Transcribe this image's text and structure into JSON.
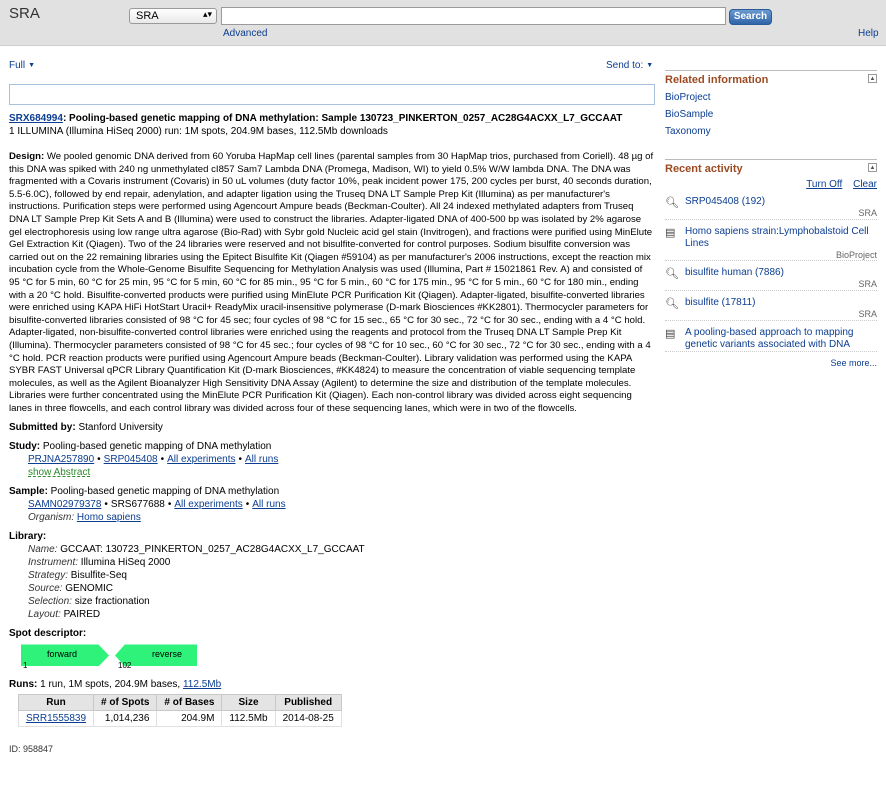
{
  "header": {
    "app_title": "SRA",
    "db_selected": "SRA",
    "search_value": "",
    "search_button": "Search",
    "advanced_link": "Advanced",
    "help_link": "Help"
  },
  "toolbar": {
    "format_label": "Full",
    "send_to_label": "Send to:"
  },
  "record": {
    "accession": "SRX684994",
    "title": ": Pooling-based genetic mapping of DNA methylation: Sample 130723_PINKERTON_0257_AC28G4ACXX_L7_GCCAAT",
    "subtitle": "1 ILLUMINA (Illumina HiSeq 2000) run: 1M spots, 204.9M bases, 112.5Mb downloads",
    "design_label": "Design:",
    "design_text": " We pooled genomic DNA derived from 60 Yoruba HapMap cell lines (parental samples from 30 HapMap trios, purchased from Coriell). 48 µg of this DNA was spiked with 240 ng unmethylated cI857 Sam7 Lambda DNA (Promega, Madison, WI) to yield 0.5% W/W lambda DNA. The DNA was fragmented with a Covaris instrument (Covaris) in 50 uL volumes (duty factor 10%, peak incident power 175, 200 cycles per burst, 40 seconds duration, 5.5-6.0C), followed by end repair, adenylation, and adapter ligation using the Truseq DNA LT Sample Prep Kit (Illumina) as per manufacturer's instructions. Purification steps were performed using Agencourt Ampure beads (Beckman-Coulter). All 24 indexed methylated adapters from Truseq DNA LT Sample Prep Kit Sets A and B (Illumina) were used to construct the libraries. Adapter-ligated DNA of 400-500 bp was isolated by 2% agarose gel electrophoresis using low range ultra agarose (Bio-Rad) with Sybr gold Nucleic acid gel stain (Invitrogen), and fractions were purified using MinElute Gel Extraction Kit (Qiagen). Two of the 24 libraries were reserved and not bisulfite-converted for control purposes. Sodium bisulfite conversion was carried out on the 22 remaining libraries using the Epitect Bisulfite Kit (Qiagen #59104) as per manufacturer's 2006 instructions, except the reaction mix incubation cycle from the Whole-Genome Bisulfite Sequencing for Methylation Analysis was used (Illumina, Part # 15021861 Rev. A) and consisted of 95 °C for 5 min, 60 °C for 25 min, 95 °C for 5 min, 60 °C for 85 min., 95 °C for 5 min., 60 °C for 175 min., 95 °C for 5 min., 60 °C for 180 min., ending with a 20 °C hold. Bisulfite-converted products were purified using MinElute PCR Purification Kit (Qiagen). Adapter-ligated, bisulfite-converted libraries were enriched using KAPA HiFi HotStart Uracil+ ReadyMix uracil-insensitive polymerase (D-mark Biosciences #KK2801). Thermocycler parameters for bisulfite-converted libraries consisted of 98 °C for 45 sec; four cycles of 98 °C for 15 sec., 65 °C for 30 sec., 72 °C for 30 sec., ending with a 4 °C hold. Adapter-ligated, non-bisulfite-converted control libraries were enriched using the reagents and protocol from the Truseq DNA LT Sample Prep Kit (Illumina). Thermocycler parameters consisted of 98 °C for 45 sec.; four cycles of 98 °C for 10 sec., 60 °C for 30 sec., 72 °C for 30 sec., ending with a 4 °C hold. PCR reaction products were purified using Agencourt Ampure beads (Beckman-Coulter). Library validation was performed using the KAPA SYBR FAST Universal qPCR Library Quantification Kit (D-mark Biosciences, #KK4824) to measure the concentration of viable sequencing template molecules, as well as the Agilent Bioanalyzer High Sensitivity DNA Assay (Agilent) to determine the size and distribution of the template molecules. Libraries were further concentrated using the MinElute PCR Purification Kit (Qiagen). Each non-control library was divided across eight sequencing lanes in three flowcells, and each control library was divided across four of these sequencing lanes, which were in two of the flowcells.",
    "submitted_label": "Submitted by:",
    "submitted_value": " Stanford University",
    "study_label": "Study:",
    "study_value": " Pooling-based genetic mapping of DNA methylation",
    "study_links": [
      "PRJNA257890",
      "SRP045408",
      "All experiments",
      "All runs"
    ],
    "show_abstract": "show Abstract",
    "sample_label": "Sample:",
    "sample_value": " Pooling-based genetic mapping of DNA methylation",
    "sample_id_link": "SAMN02979378",
    "sample_srs": "SRS677688",
    "sample_links": [
      "All experiments",
      "All runs"
    ],
    "organism_label": "Organism:",
    "organism_value": "Homo sapiens",
    "library_label": "Library:",
    "library_fields": [
      {
        "label": "Name:",
        "value": " GCCAAT: 130723_PINKERTON_0257_AC28G4ACXX_L7_GCCAAT"
      },
      {
        "label": "Instrument:",
        "value": " Illumina HiSeq 2000"
      },
      {
        "label": "Strategy:",
        "value": " Bisulfite-Seq"
      },
      {
        "label": "Source:",
        "value": " GENOMIC"
      },
      {
        "label": "Selection:",
        "value": " size fractionation"
      },
      {
        "label": "Layout:",
        "value": " PAIRED"
      }
    ],
    "spot_label": "Spot descriptor:",
    "spot": {
      "forward": "forward",
      "reverse": "reverse",
      "pos1": "1",
      "pos2": "102"
    },
    "runs_label": "Runs:",
    "runs_summary": " 1 run, 1M spots, 204.9M bases,",
    "runs_size_link": "112.5Mb",
    "runs_table": {
      "headers": [
        "Run",
        "# of Spots",
        "# of Bases",
        "Size",
        "Published"
      ],
      "rows": [
        [
          "SRR1555839",
          "1,014,236",
          "204.9M",
          "112.5Mb",
          "2014-08-25"
        ]
      ]
    },
    "id_line": "ID: 958847"
  },
  "sidebar": {
    "related_title": "Related information",
    "related_links": [
      "BioProject",
      "BioSample",
      "Taxonomy"
    ],
    "activity_title": "Recent activity",
    "turn_off": "Turn Off",
    "clear": "Clear",
    "activity": [
      {
        "text": "SRP045408 (192)",
        "source": "SRA",
        "icon": "search-icon"
      },
      {
        "text": "Homo sapiens strain:Lymphobalstoid Cell Lines",
        "source": "BioProject",
        "icon": "document-icon"
      },
      {
        "text": "bisulfite human (7886)",
        "source": "SRA",
        "icon": "search-icon"
      },
      {
        "text": "bisulfite (17811)",
        "source": "SRA",
        "icon": "search-icon"
      },
      {
        "text": "A pooling-based approach to mapping genetic variants associated with DNA",
        "source": "",
        "icon": "document-icon"
      }
    ],
    "see_more": "See more..."
  }
}
